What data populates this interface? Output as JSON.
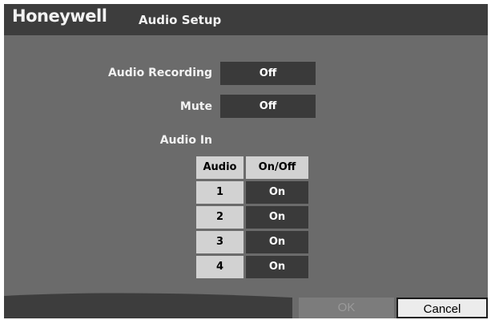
{
  "header": {
    "brand": "Honeywell",
    "title": "Audio Setup"
  },
  "settings": {
    "audio_recording_label": "Audio Recording",
    "audio_recording_value": "Off",
    "mute_label": "Mute",
    "mute_value": "Off"
  },
  "audio_in": {
    "section_label": "Audio In",
    "col_headers": [
      "Audio",
      "On/Off"
    ],
    "rows": [
      {
        "channel": "1",
        "state": "On"
      },
      {
        "channel": "2",
        "state": "On"
      },
      {
        "channel": "3",
        "state": "On"
      },
      {
        "channel": "4",
        "state": "On"
      }
    ]
  },
  "footer": {
    "ok_label": "OK",
    "cancel_label": "Cancel"
  },
  "colors": {
    "panel": "#6b6b6b",
    "titlebar": "#3d3d3d",
    "value_bg": "#3a3a3a",
    "header_cell": "#d2d2d2"
  }
}
